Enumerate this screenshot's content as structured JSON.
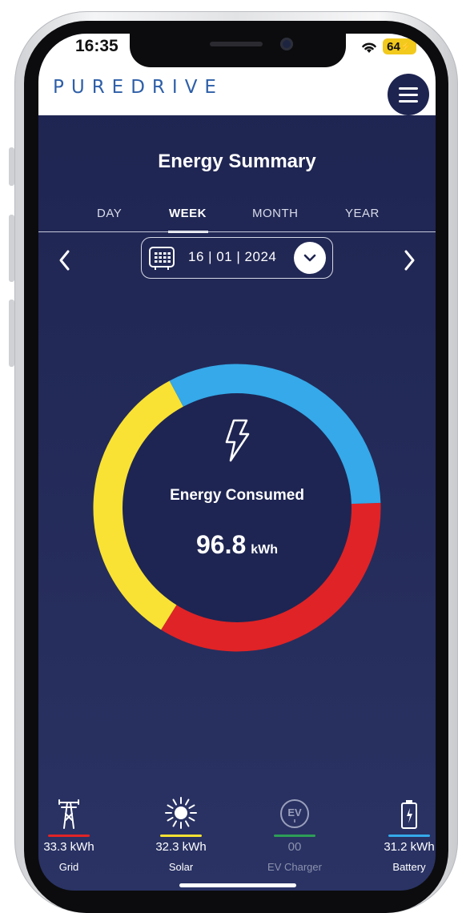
{
  "status_bar": {
    "time": "16:35",
    "battery": "64"
  },
  "header": {
    "logo": "PUREDRIVE"
  },
  "page": {
    "title": "Energy Summary"
  },
  "tabs": [
    {
      "label": "DAY",
      "active": false
    },
    {
      "label": "WEEK",
      "active": true
    },
    {
      "label": "MONTH",
      "active": false
    },
    {
      "label": "YEAR",
      "active": false
    }
  ],
  "date_picker": {
    "value": "16 | 01 | 2024"
  },
  "summary": {
    "label": "Energy Consumed",
    "value": "96.8",
    "unit": "kWh"
  },
  "chart_data": {
    "type": "pie",
    "categories": [
      "Grid",
      "Solar",
      "EV Charger",
      "Battery"
    ],
    "values": [
      33.3,
      32.3,
      0,
      31.2
    ],
    "colors": [
      "#e02326",
      "#f9e233",
      "#2e9e57",
      "#35a9e9"
    ],
    "total": 96.8
  },
  "metrics": [
    {
      "value": "33.3 kWh",
      "label": "Grid",
      "color": "#e02326",
      "icon": "power-pole-icon"
    },
    {
      "value": "32.3 kWh",
      "label": "Solar",
      "color": "#f9e233",
      "icon": "sun-icon"
    },
    {
      "value": "00",
      "label": "EV Charger",
      "color": "#2e9e57",
      "icon": "ev-icon"
    },
    {
      "value": "31.2 kWh",
      "label": "Battery",
      "color": "#35a9e9",
      "icon": "battery-icon"
    }
  ]
}
